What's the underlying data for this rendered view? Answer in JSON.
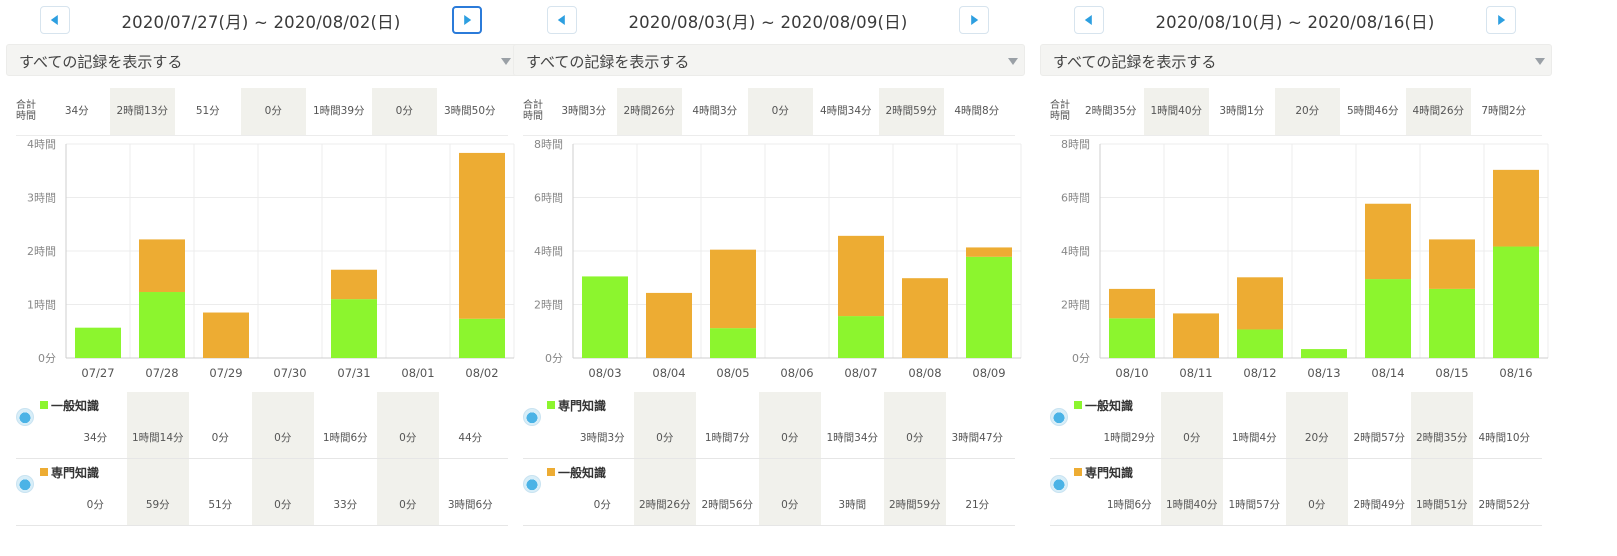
{
  "colors": {
    "general": "#8cf52e",
    "special": "#edac33",
    "accent": "#2d9fe0"
  },
  "icons": {
    "prev": "triangle-left-icon",
    "next": "triangle-right-icon",
    "dropdown": "caret-down-icon",
    "category": "study-icon"
  },
  "totals_header": [
    "合計",
    "時間"
  ],
  "panels": [
    {
      "title": "2020/07/27(月) ~ 2020/08/02(日)",
      "filter": "すべての記録を表示する",
      "totals": [
        "34分",
        "2時間13分",
        "51分",
        "0分",
        "1時間39分",
        "0分",
        "3時間50分"
      ],
      "categories": [
        {
          "name": "一般知識",
          "color": "#8cf52e",
          "values": [
            "34分",
            "1時間14分",
            "0分",
            "0分",
            "1時間6分",
            "0分",
            "44分"
          ]
        },
        {
          "name": "専門知識",
          "color": "#edac33",
          "values": [
            "0分",
            "59分",
            "51分",
            "0分",
            "33分",
            "0分",
            "3時間6分"
          ]
        }
      ],
      "chart_data": {
        "type": "bar",
        "stacked": true,
        "categories": [
          "07/27",
          "07/28",
          "07/29",
          "07/30",
          "07/31",
          "08/01",
          "08/02"
        ],
        "series": [
          {
            "name": "一般知識",
            "color": "#8cf52e",
            "values": [
              34,
              74,
              0,
              0,
              66,
              0,
              44
            ]
          },
          {
            "name": "専門知識",
            "color": "#edac33",
            "values": [
              0,
              59,
              51,
              0,
              33,
              0,
              186
            ]
          }
        ],
        "ylim": [
          0,
          240
        ],
        "y_ticks": [
          0,
          60,
          120,
          180,
          240
        ],
        "y_tick_labels": [
          "0分",
          "1時間",
          "2時間",
          "3時間",
          "4時間"
        ],
        "grid": true
      }
    },
    {
      "title": "2020/08/03(月) ~ 2020/08/09(日)",
      "filter": "すべての記録を表示する",
      "totals": [
        "3時間3分",
        "2時間26分",
        "4時間3分",
        "0分",
        "4時間34分",
        "2時間59分",
        "4時間8分"
      ],
      "categories": [
        {
          "name": "専門知識",
          "color": "#8cf52e",
          "values": [
            "3時間3分",
            "0分",
            "1時間7分",
            "0分",
            "1時間34分",
            "0分",
            "3時間47分"
          ]
        },
        {
          "name": "一般知識",
          "color": "#edac33",
          "values": [
            "0分",
            "2時間26分",
            "2時間56分",
            "0分",
            "3時間",
            "2時間59分",
            "21分"
          ]
        }
      ],
      "chart_data": {
        "type": "bar",
        "stacked": true,
        "categories": [
          "08/03",
          "08/04",
          "08/05",
          "08/06",
          "08/07",
          "08/08",
          "08/09"
        ],
        "series": [
          {
            "name": "専門知識",
            "color": "#8cf52e",
            "values": [
              183,
              0,
              67,
              0,
              94,
              0,
              227
            ]
          },
          {
            "name": "一般知識",
            "color": "#edac33",
            "values": [
              0,
              146,
              176,
              0,
              180,
              179,
              21
            ]
          }
        ],
        "ylim": [
          0,
          480
        ],
        "y_ticks": [
          0,
          120,
          240,
          360,
          480
        ],
        "y_tick_labels": [
          "0分",
          "2時間",
          "4時間",
          "6時間",
          "8時間"
        ],
        "grid": true
      }
    },
    {
      "title": "2020/08/10(月) ~ 2020/08/16(日)",
      "filter": "すべての記録を表示する",
      "totals": [
        "2時間35分",
        "1時間40分",
        "3時間1分",
        "20分",
        "5時間46分",
        "4時間26分",
        "7時間2分"
      ],
      "categories": [
        {
          "name": "一般知識",
          "color": "#8cf52e",
          "values": [
            "1時間29分",
            "0分",
            "1時間4分",
            "20分",
            "2時間57分",
            "2時間35分",
            "4時間10分"
          ]
        },
        {
          "name": "専門知識",
          "color": "#edac33",
          "values": [
            "1時間6分",
            "1時間40分",
            "1時間57分",
            "0分",
            "2時間49分",
            "1時間51分",
            "2時間52分"
          ]
        }
      ],
      "chart_data": {
        "type": "bar",
        "stacked": true,
        "categories": [
          "08/10",
          "08/11",
          "08/12",
          "08/13",
          "08/14",
          "08/15",
          "08/16"
        ],
        "series": [
          {
            "name": "一般知識",
            "color": "#8cf52e",
            "values": [
              89,
              0,
              64,
              20,
              177,
              155,
              250
            ]
          },
          {
            "name": "専門知識",
            "color": "#edac33",
            "values": [
              66,
              100,
              117,
              0,
              169,
              111,
              172
            ]
          }
        ],
        "ylim": [
          0,
          480
        ],
        "y_ticks": [
          0,
          120,
          240,
          360,
          480
        ],
        "y_tick_labels": [
          "0分",
          "2時間",
          "4時間",
          "6時間",
          "8時間"
        ],
        "grid": true
      }
    }
  ]
}
